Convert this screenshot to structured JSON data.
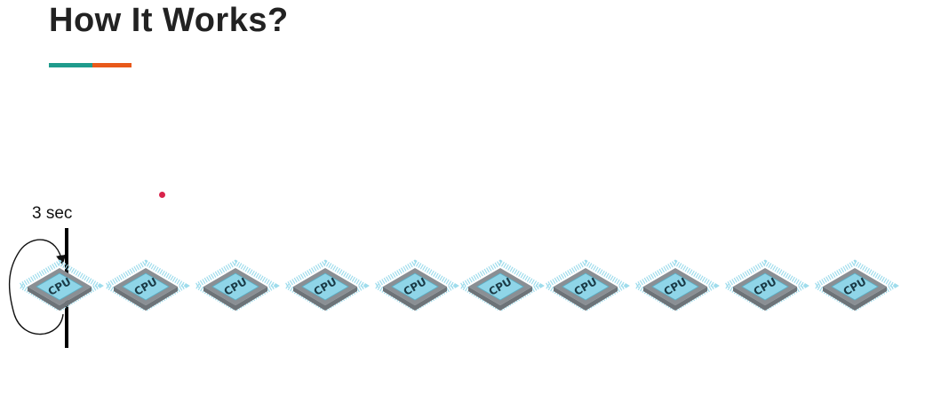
{
  "slide": {
    "title": "How It Works?"
  },
  "colors": {
    "accent_teal": "#1f9b8c",
    "accent_orange": "#e8591a",
    "dot": "#d9234b",
    "cpu_top": "#8fd5e8",
    "cpu_base": "#8a8f94",
    "cpu_pins": "#9edcec"
  },
  "diagram": {
    "time_label": "3 sec",
    "cpu_label": "CPU",
    "cpus": [
      {
        "label": "CPU"
      },
      {
        "label": "CPU"
      },
      {
        "label": "CPU"
      },
      {
        "label": "CPU"
      },
      {
        "label": "CPU"
      },
      {
        "label": "CPU"
      },
      {
        "label": "CPU"
      },
      {
        "label": "CPU"
      },
      {
        "label": "CPU"
      },
      {
        "label": "CPU"
      }
    ]
  }
}
